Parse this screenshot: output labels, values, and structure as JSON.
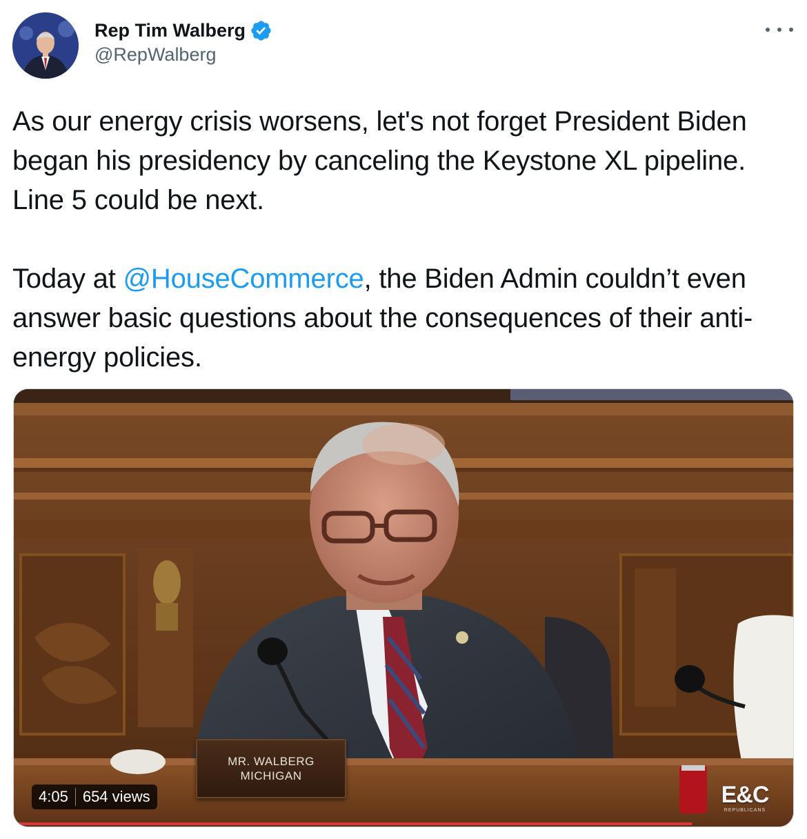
{
  "author": {
    "name": "Rep Tim Walberg",
    "handle": "@RepWalberg",
    "verified": true,
    "avatar_icon": "profile-photo"
  },
  "menu": {
    "icon": "more-horizontal-icon"
  },
  "tweet": {
    "paragraph1": "As our energy crisis worsens, let's not forget President Biden began his presidency by canceling the Keystone XL pipeline. Line 5 could be next.",
    "paragraph2_before": "Today at ",
    "mention": "@HouseCommerce",
    "paragraph2_after": ", the Biden Admin couldn’t even answer basic questions about the consequences of their anti-energy policies."
  },
  "video": {
    "duration": "4:05",
    "views": "654 views",
    "nameplate_line1": "MR. WALBERG",
    "nameplate_line2": "MICHIGAN",
    "watermark_main": "E&C",
    "watermark_sub": "REPUBLICANS",
    "progress": 0.87
  },
  "colors": {
    "link": "#1d9bf0",
    "verified": "#1d9bf0",
    "text": "#0f1419",
    "secondary": "#536471"
  }
}
